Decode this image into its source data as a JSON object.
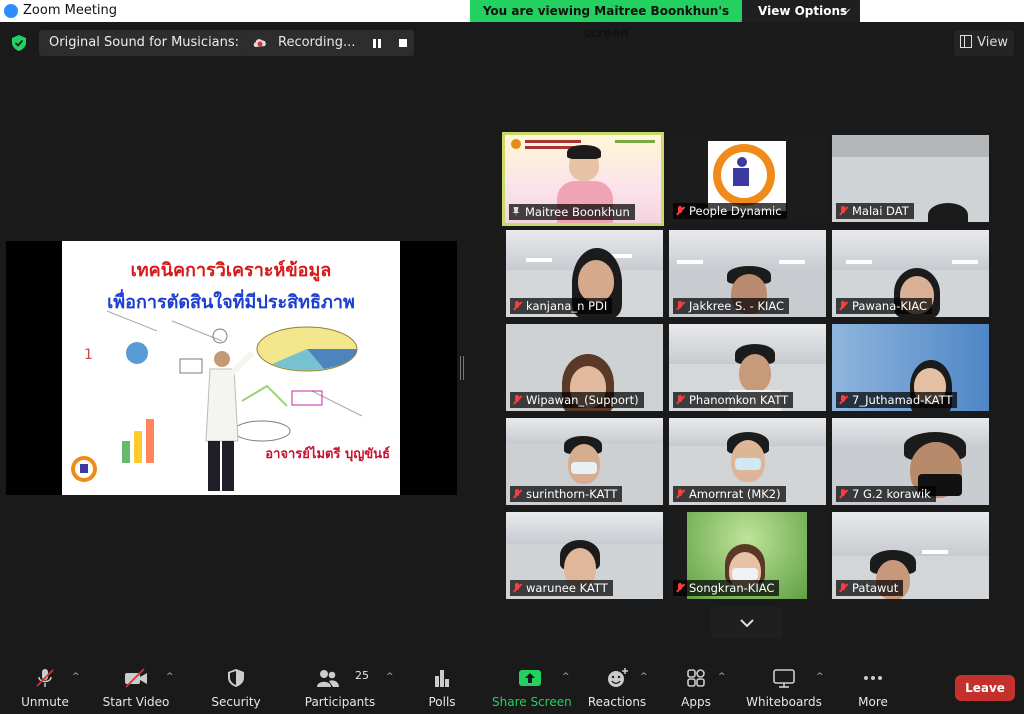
{
  "window": {
    "title": "Zoom Meeting"
  },
  "banner": {
    "viewing_text": "You are viewing Maitree Boonkhun's screen",
    "view_options": "View Options"
  },
  "topbar": {
    "original_sound": "Original Sound for Musicians: Off",
    "recording": "Recording...",
    "view": "View"
  },
  "slide": {
    "line1": "เทคนิคการวิเคราะห์ข้อมูล",
    "line2": "เพื่อการตัดสินใจที่มีประสิทธิภาพ",
    "presenter": "อาจารย์ไมตรี บุญขันธ์"
  },
  "participants": [
    {
      "name": "Maitree Boonkhun",
      "active": true
    },
    {
      "name": "People Dynamic"
    },
    {
      "name": "Malai DAT"
    },
    {
      "name": "kanjana_n PDI"
    },
    {
      "name": "Jakkree S. - KIAC"
    },
    {
      "name": "Pawana-KIAC"
    },
    {
      "name": "Wipawan_(Support)"
    },
    {
      "name": "Phanomkon KATT"
    },
    {
      "name": "7_Juthamad-KATT"
    },
    {
      "name": "surinthorn-KATT"
    },
    {
      "name": "Amornrat (MK2)"
    },
    {
      "name": "7 G.2 korawik"
    },
    {
      "name": "warunee KATT"
    },
    {
      "name": "Songkran-KIAC"
    },
    {
      "name": "Patawut"
    }
  ],
  "toolbar": {
    "unmute": "Unmute",
    "start_video": "Start Video",
    "security": "Security",
    "participants": "Participants",
    "participants_count": "25",
    "polls": "Polls",
    "share_screen": "Share Screen",
    "reactions": "Reactions",
    "apps": "Apps",
    "whiteboards": "Whiteboards",
    "more": "More",
    "leave": "Leave"
  },
  "colors": {
    "accent_green": "#23d160",
    "leave_red": "#c4302b",
    "active_border": "#c9d96a"
  }
}
